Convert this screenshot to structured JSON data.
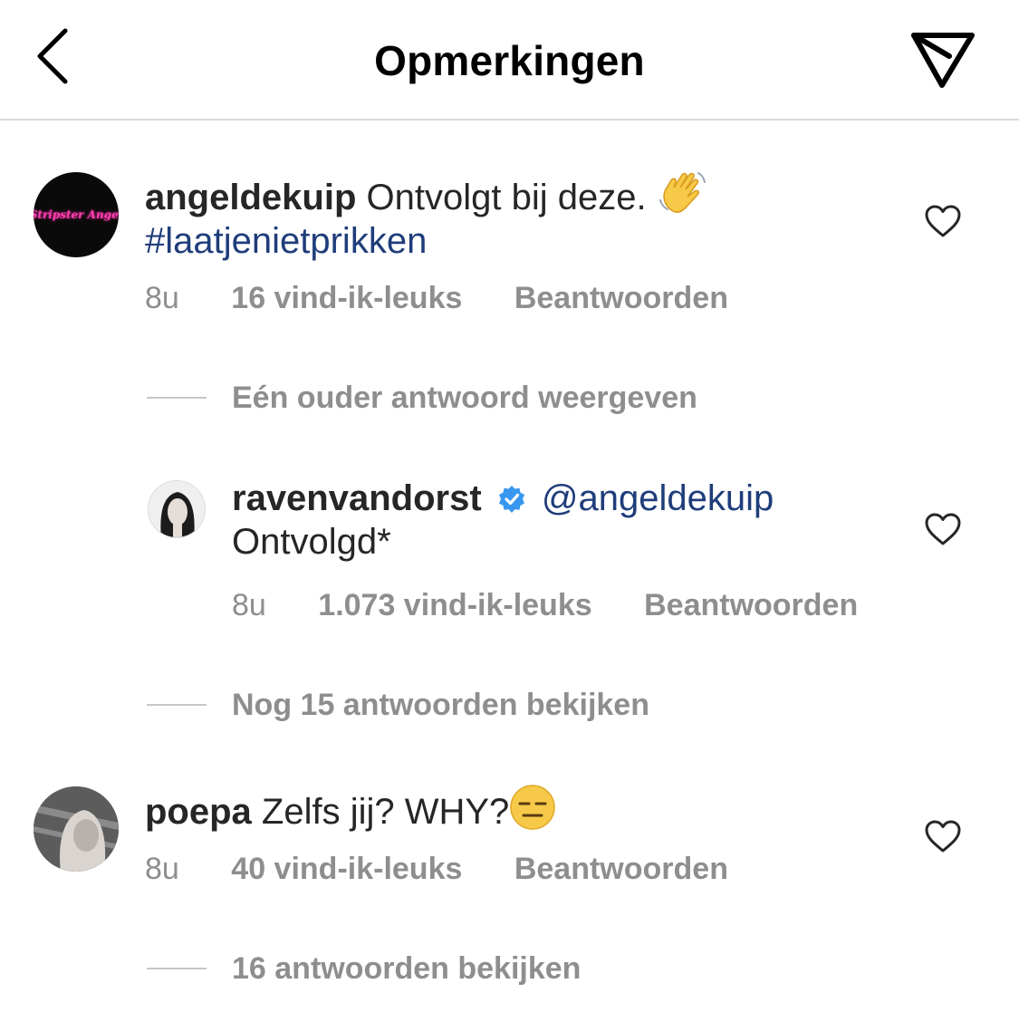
{
  "header": {
    "title": "Opmerkingen"
  },
  "comments": [
    {
      "avatar_text": "Stripster Angel",
      "username": "angeldekuip",
      "text": "Ontvolgt bij deze.",
      "hashtag": "#laatjenietprikken",
      "time": "8u",
      "likes": "16 vind-ik-leuks",
      "reply_label": "Beantwoorden",
      "thread_label": "Eén ouder antwoord weergeven",
      "reply": {
        "username": "ravenvandorst",
        "verified": true,
        "mention": "@angeldekuip",
        "text": "Ontvolgd*",
        "time": "8u",
        "likes": "1.073 vind-ik-leuks",
        "reply_label": "Beantwoorden"
      },
      "more_replies_label": "Nog 15 antwoorden bekijken"
    },
    {
      "username": "poepa",
      "text": "Zelfs jij? WHY?",
      "time": "8u",
      "likes": "40 vind-ik-leuks",
      "reply_label": "Beantwoorden",
      "thread_label": "16 antwoorden bekijken"
    }
  ],
  "icons": {
    "back": "chevron-left-icon",
    "send": "paper-plane-icon",
    "like": "heart-outline-icon",
    "verified": "verified-badge-icon",
    "wave": "waving-hand-emoji",
    "expressionless": "expressionless-face-emoji"
  },
  "colors": {
    "hashtag": "#1f3d7a",
    "verified": "#3897f0",
    "secondary_text": "#8e8e8e",
    "divider": "#dbdbdb"
  }
}
